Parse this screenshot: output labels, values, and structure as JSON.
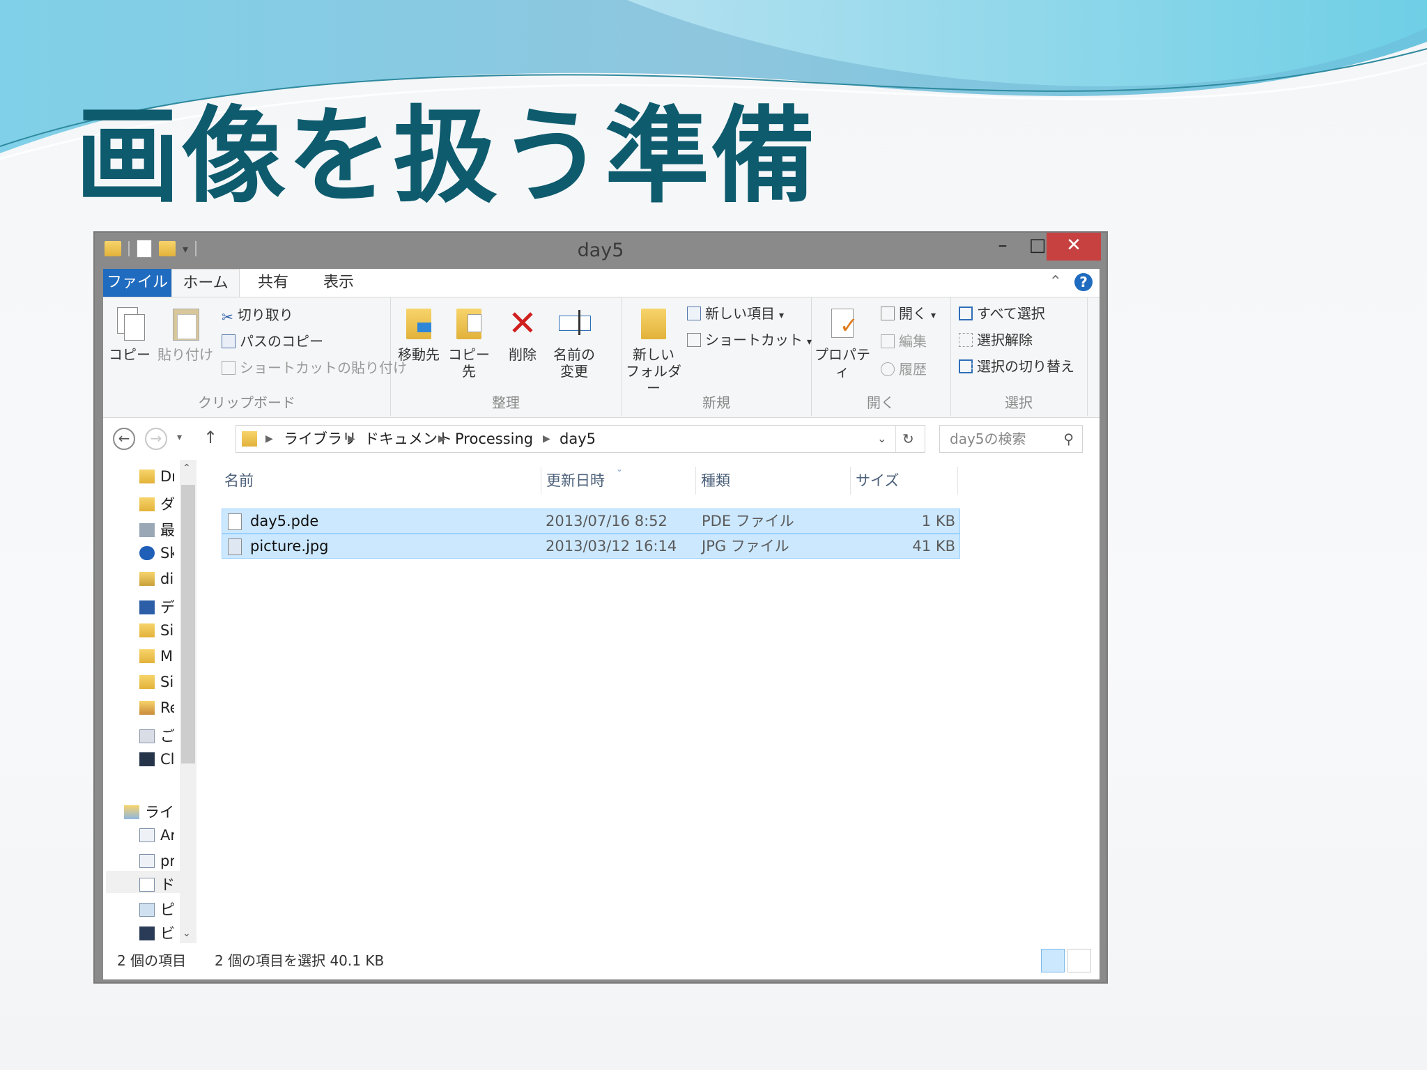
{
  "slide": {
    "title": "画像を扱う準備"
  },
  "window": {
    "title": "day5",
    "controls": {
      "minimize": "–",
      "maximize": "□",
      "close": "✕"
    },
    "menu_tabs": [
      "ファイル",
      "ホーム",
      "共有",
      "表示"
    ],
    "help": "?",
    "collapse": "⌃"
  },
  "ribbon": {
    "clipboard": {
      "label": "クリップボード",
      "copy": "コピー",
      "paste": "貼り付け",
      "cut": "切り取り",
      "copy_path": "パスのコピー",
      "paste_shortcut": "ショートカットの貼り付け"
    },
    "organize": {
      "label": "整理",
      "move_to": "移動先",
      "copy_to": "コピー先",
      "delete": "削除",
      "rename_1": "名前の",
      "rename_2": "変更"
    },
    "new": {
      "label": "新規",
      "new_folder_1": "新しい",
      "new_folder_2": "フォルダー",
      "new_item": "新しい項目",
      "shortcut": "ショートカット"
    },
    "open": {
      "label": "開く",
      "properties": "プロパティ",
      "open": "開く",
      "edit": "編集",
      "history": "履歴"
    },
    "select": {
      "label": "選択",
      "select_all": "すべて選択",
      "select_none": "選択解除",
      "invert": "選択の切り替え"
    }
  },
  "address": {
    "breadcrumbs": [
      "ライブラリ",
      "ドキュメント",
      "Processing",
      "day5"
    ],
    "search_placeholder": "day5の検索"
  },
  "nav_pane": {
    "items": [
      "Dr",
      "ダ",
      "最",
      "Sk",
      "di",
      "デ",
      "Si",
      "M",
      "Si",
      "Re",
      "ご",
      "Cl"
    ],
    "libraries": "ライブ",
    "library_items": [
      "Ar",
      "pr",
      "ド",
      "ピ",
      "ビ"
    ]
  },
  "columns": {
    "name": "名前",
    "date": "更新日時",
    "type": "種類",
    "size": "サイズ"
  },
  "files": [
    {
      "name": "day5.pde",
      "date": "2013/07/16 8:52",
      "type": "PDE ファイル",
      "size": "1 KB"
    },
    {
      "name": "picture.jpg",
      "date": "2013/03/12 16:14",
      "type": "JPG ファイル",
      "size": "41 KB"
    }
  ],
  "status": {
    "item_count": "2 個の項目",
    "selection": "2 個の項目を選択  40.1 KB"
  },
  "colors": {
    "title": "#0e5b6e",
    "file_tab": "#1f6bbf",
    "selection": "#cce8ff",
    "close": "#c74141"
  }
}
